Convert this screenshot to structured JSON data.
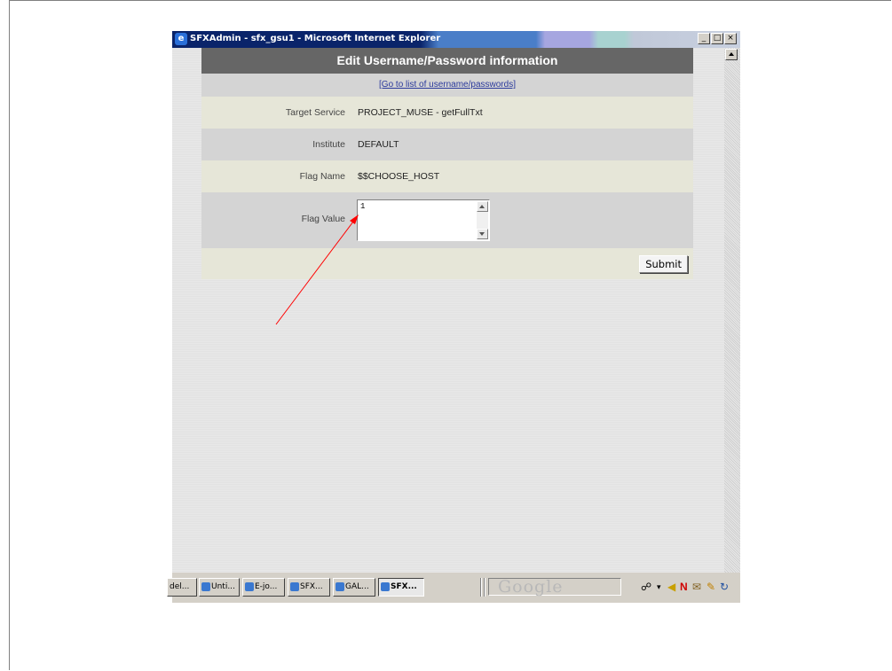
{
  "window": {
    "title": "SFXAdmin - sfx_gsu1 - Microsoft Internet Explorer",
    "buttons": [
      "_",
      "□",
      "×"
    ]
  },
  "form": {
    "header": "Edit Username/Password information",
    "back_link": "[Go to list of username/passwords]",
    "fields": [
      {
        "label": "Target Service",
        "value": "PROJECT_MUSE - getFullTxt"
      },
      {
        "label": "Institute",
        "value": "DEFAULT"
      },
      {
        "label": "Flag Name",
        "value": "$$CHOOSE_HOST"
      },
      {
        "label": "Flag Value",
        "value": "1"
      }
    ],
    "submit_label": "Submit"
  },
  "taskbar": {
    "items": [
      "del...",
      "Unti...",
      "E-jo...",
      "SFX...",
      "GAL...",
      "SFX..."
    ],
    "active_index": 5,
    "search_brand": "Google",
    "tray_icons": [
      "binoculars-icon",
      "arrow-icon",
      "n-icon",
      "mail-icon",
      "pencil-icon",
      "undo-icon"
    ]
  },
  "colors": {
    "title_gradient_start": "#0a246a",
    "header_bg": "#666666",
    "row_beige": "#e6e6d8",
    "row_gray": "#d4d4d4",
    "link": "#2b3a9c",
    "annotation_arrow": "#ff0000"
  },
  "annotation": {
    "type": "arrow",
    "target": "flag-value-textarea"
  }
}
